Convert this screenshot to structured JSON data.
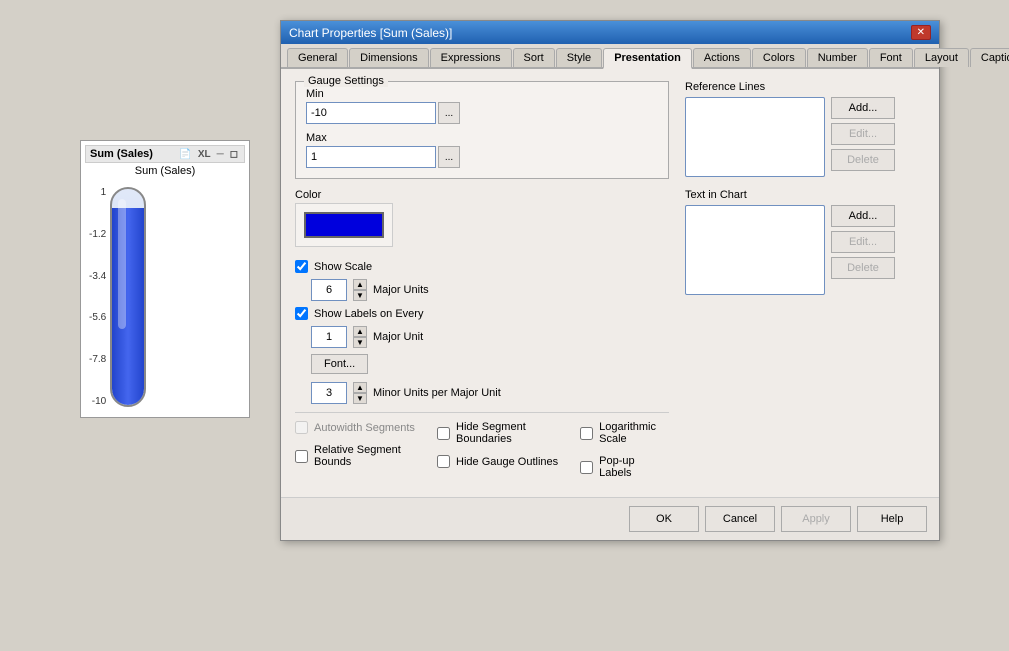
{
  "preview": {
    "title": "Sum (Sales)",
    "chart_title": "Sum (Sales)",
    "icons": [
      "xl",
      "min",
      "close"
    ],
    "y_axis_labels": [
      "1",
      "-1.2",
      "-3.4",
      "-5.6",
      "-7.8",
      "-10"
    ]
  },
  "dialog": {
    "title": "Chart Properties [Sum (Sales)]",
    "close_label": "✕",
    "tabs": [
      {
        "id": "general",
        "label": "General"
      },
      {
        "id": "dimensions",
        "label": "Dimensions"
      },
      {
        "id": "expressions",
        "label": "Expressions"
      },
      {
        "id": "sort",
        "label": "Sort"
      },
      {
        "id": "style",
        "label": "Style"
      },
      {
        "id": "presentation",
        "label": "Presentation"
      },
      {
        "id": "actions",
        "label": "Actions"
      },
      {
        "id": "colors",
        "label": "Colors"
      },
      {
        "id": "number",
        "label": "Number"
      },
      {
        "id": "font",
        "label": "Font"
      },
      {
        "id": "layout",
        "label": "Layout"
      },
      {
        "id": "caption",
        "label": "Caption"
      }
    ],
    "active_tab": "presentation",
    "gauge_settings": {
      "label": "Gauge Settings",
      "min_label": "Min",
      "min_value": "-10",
      "max_label": "Max",
      "max_value": "1",
      "ellipsis": "..."
    },
    "color_section": {
      "label": "Color"
    },
    "show_scale": {
      "checked": true,
      "label": "Show Scale",
      "major_units_value": "6",
      "major_units_label": "Major Units"
    },
    "show_labels": {
      "checked": true,
      "label": "Show Labels on Every",
      "value": "1",
      "unit_label": "Major Unit",
      "font_btn": "Font..."
    },
    "minor_units": {
      "value": "3",
      "label": "Minor Units per Major Unit"
    },
    "reference_lines": {
      "label": "Reference Lines",
      "add_btn": "Add...",
      "edit_btn": "Edit...",
      "delete_btn": "Delete"
    },
    "text_in_chart": {
      "label": "Text in Chart",
      "add_btn": "Add...",
      "edit_btn": "Edit...",
      "delete_btn": "Delete"
    },
    "checkboxes": {
      "autowidth": {
        "label": "Autowidth Segments",
        "checked": false,
        "disabled": true
      },
      "relative": {
        "label": "Relative Segment Bounds",
        "checked": false,
        "disabled": false
      },
      "hide_boundaries": {
        "label": "Hide Segment Boundaries",
        "checked": false,
        "disabled": false
      },
      "hide_outlines": {
        "label": "Hide Gauge Outlines",
        "checked": false,
        "disabled": false
      },
      "logarithmic": {
        "label": "Logarithmic Scale",
        "checked": false,
        "disabled": false
      },
      "popup_labels": {
        "label": "Pop-up Labels",
        "checked": false,
        "disabled": false
      }
    },
    "footer": {
      "ok": "OK",
      "cancel": "Cancel",
      "apply": "Apply",
      "help": "Help"
    }
  }
}
